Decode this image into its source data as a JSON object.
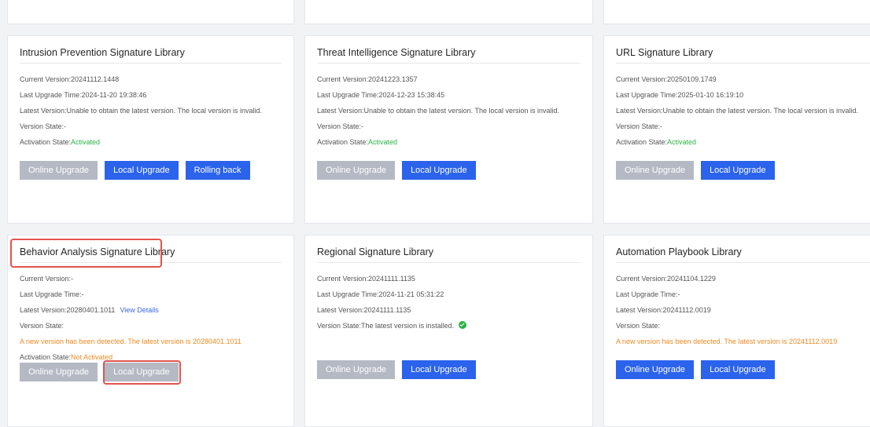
{
  "cards": {
    "ips": {
      "title": "Intrusion Prevention Signature Library",
      "current_version": "Current Version:20241112.1448",
      "last_upgrade": "Last Upgrade Time:2024-11-20 19:38:46",
      "latest_version": "Latest Version:Unable to obtain the latest version. The local version is invalid.",
      "version_state": "Version State:-",
      "activation_label": "Activation State:",
      "activation_value": "Activated",
      "btn_online": "Online Upgrade",
      "btn_local": "Local Upgrade",
      "btn_rollback": "Rolling back"
    },
    "threat": {
      "title": "Threat Intelligence Signature Library",
      "current_version": "Current Version:20241223.1357",
      "last_upgrade": "Last Upgrade Time:2024-12-23 15:38:45",
      "latest_version": "Latest Version:Unable to obtain the latest version. The local version is invalid.",
      "version_state": "Version State:-",
      "activation_label": "Activation State:",
      "activation_value": "Activated",
      "btn_online": "Online Upgrade",
      "btn_local": "Local Upgrade"
    },
    "url": {
      "title": "URL Signature Library",
      "current_version": "Current Version:20250109.1749",
      "last_upgrade": "Last Upgrade Time:2025-01-10 16:19:10",
      "latest_version": "Latest Version:Unable to obtain the latest version. The local version is invalid.",
      "version_state": "Version State:-",
      "activation_label": "Activation State:",
      "activation_value": "Activated",
      "btn_online": "Online Upgrade",
      "btn_local": "Local Upgrade"
    },
    "behavior": {
      "title": "Behavior Analysis Signature Library",
      "current_version": "Current Version:-",
      "last_upgrade": "Last Upgrade Time:-",
      "latest_version": "Latest Version:20280401.1011",
      "view_details": "View Details",
      "version_state": "Version State:",
      "new_version_msg": "A new version has been detected. The latest version is 20280401.1011",
      "activation_label": "Activation State:",
      "activation_value": "Not Activated",
      "btn_online": "Online Upgrade",
      "btn_local": "Local Upgrade"
    },
    "regional": {
      "title": "Regional Signature Library",
      "current_version": "Current Version:20241111.1135",
      "last_upgrade": "Last Upgrade Time:2024-11-21 05:31:22",
      "latest_version": "Latest Version:20241111.1135",
      "version_state": "Version State:The latest version is installed.",
      "btn_online": "Online Upgrade",
      "btn_local": "Local Upgrade"
    },
    "automation": {
      "title": "Automation Playbook Library",
      "current_version": "Current Version:20241104.1229",
      "last_upgrade": "Last Upgrade Time:-",
      "latest_version": "Latest Version:20241112.0019",
      "version_state": "Version State:",
      "new_version_msg": "A new version has been detected. The latest version is 20241112.0019",
      "btn_online": "Online Upgrade",
      "btn_local": "Local Upgrade"
    }
  },
  "colors": {
    "primary": "#2b63ec",
    "disabled": "#b4b9c4",
    "activated": "#2bb246",
    "warning": "#f08a24",
    "highlight": "#e2534f"
  }
}
